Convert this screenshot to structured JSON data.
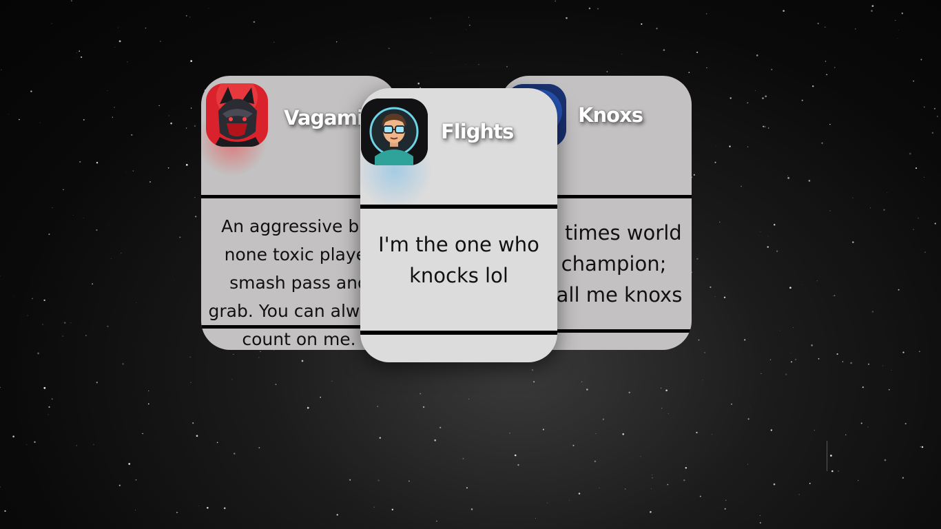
{
  "background": {
    "color": "#0a0a0a",
    "description_icon": "starfield"
  },
  "cards": [
    {
      "id": "left",
      "name": "Vagamie",
      "bio": "An aggressive but none toxic player smash pass and grab. You can always count on me.",
      "avatar_icon": "red-wolf-gamer-avatar",
      "accent": "#e23b3b"
    },
    {
      "id": "center",
      "name": "Flights",
      "bio": "I'm the one who knocks lol",
      "avatar_icon": "glasses-boy-avatar",
      "accent": "#7fc3ea"
    },
    {
      "id": "right",
      "name": "Knoxs",
      "bio": "5 times world champion; call me knoxs",
      "avatar_icon": "blue-orb-avatar",
      "accent": "#1d3f8c"
    }
  ]
}
